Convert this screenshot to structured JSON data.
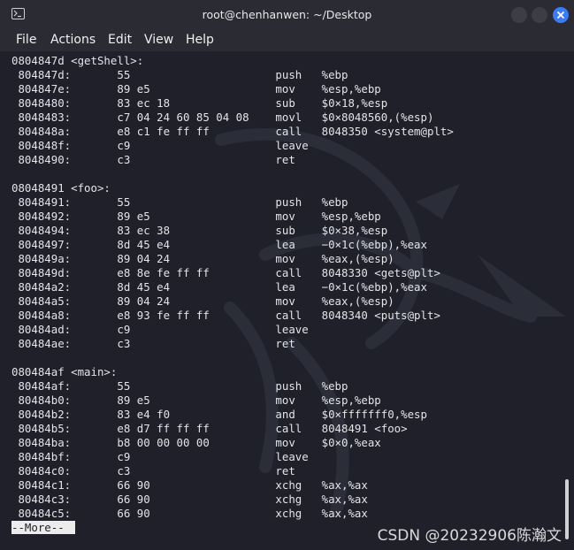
{
  "window": {
    "title": "root@chenhanwen: ~/Desktop"
  },
  "menu": {
    "items": [
      "File",
      "Actions",
      "Edit",
      "View",
      "Help"
    ]
  },
  "terminal": {
    "lines": [
      "0804847d <getShell>:",
      " 804847d:\t55                   \tpush   %ebp",
      " 804847e:\t89 e5                \tmov    %esp,%ebp",
      " 8048480:\t83 ec 18             \tsub    $0×18,%esp",
      " 8048483:\tc7 04 24 60 85 04 08 \tmovl   $0×8048560,(%esp)",
      " 804848a:\te8 c1 fe ff ff       \tcall   8048350 <system@plt>",
      " 804848f:\tc9                   \tleave",
      " 8048490:\tc3                   \tret",
      "",
      "08048491 <foo>:",
      " 8048491:\t55                   \tpush   %ebp",
      " 8048492:\t89 e5                \tmov    %esp,%ebp",
      " 8048494:\t83 ec 38             \tsub    $0×38,%esp",
      " 8048497:\t8d 45 e4             \tlea    −0×1c(%ebp),%eax",
      " 804849a:\t89 04 24             \tmov    %eax,(%esp)",
      " 804849d:\te8 8e fe ff ff       \tcall   8048330 <gets@plt>",
      " 80484a2:\t8d 45 e4             \tlea    −0×1c(%ebp),%eax",
      " 80484a5:\t89 04 24             \tmov    %eax,(%esp)",
      " 80484a8:\te8 93 fe ff ff       \tcall   8048340 <puts@plt>",
      " 80484ad:\tc9                   \tleave",
      " 80484ae:\tc3                   \tret",
      "",
      "080484af <main>:",
      " 80484af:\t55                   \tpush   %ebp",
      " 80484b0:\t89 e5                \tmov    %esp,%ebp",
      " 80484b2:\t83 e4 f0             \tand    $0×fffffff0,%esp",
      " 80484b5:\te8 d7 ff ff ff       \tcall   8048491 <foo>",
      " 80484ba:\tb8 00 00 00 00       \tmov    $0×0,%eax",
      " 80484bf:\tc9                   \tleave",
      " 80484c0:\tc3                   \tret",
      " 80484c1:\t66 90                \txchg   %ax,%ax",
      " 80484c3:\t66 90                \txchg   %ax,%ax",
      " 80484c5:\t66 90                \txchg   %ax,%ax"
    ],
    "pager_prompt": "--More--"
  },
  "watermark": "CSDN @20232906陈瀚文",
  "colors": {
    "background": "#1f2029",
    "titlebar": "#2a2b33",
    "text": "#e4e4e8",
    "close_button": "#3d7bf5"
  },
  "icons": {
    "app": "terminal-icon",
    "minimize": "minimize-icon",
    "maximize": "maximize-icon",
    "close": "close-icon"
  }
}
